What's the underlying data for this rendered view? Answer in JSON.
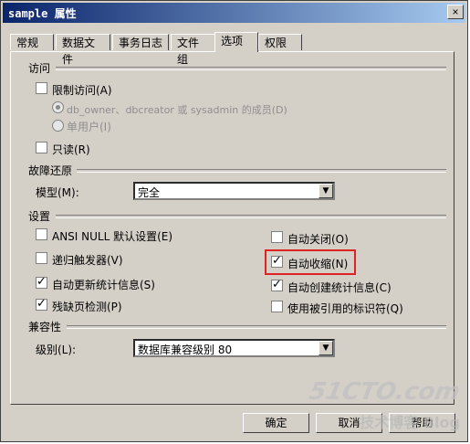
{
  "window": {
    "title": "sample 属性",
    "close": "×"
  },
  "tabs": [
    {
      "label": "常规"
    },
    {
      "label": "数据文件"
    },
    {
      "label": "事务日志"
    },
    {
      "label": "文件组"
    },
    {
      "label": "选项"
    },
    {
      "label": "权限"
    }
  ],
  "access": {
    "heading": "访问",
    "restrict": "限制访问(A)",
    "members": "db_owner、dbcreator 或 sysadmin 的成员(D)",
    "single": "单用户(I)",
    "readonly": "只读(R)"
  },
  "recovery": {
    "heading": "故障还原",
    "model_label": "模型(M):",
    "model_value": "完全"
  },
  "settings": {
    "heading": "设置",
    "ansi_null": "ANSI NULL 默认设置(E)",
    "recursive": "递归触发器(V)",
    "auto_update": "自动更新统计信息(S)",
    "torn_page": "残缺页检测(P)",
    "auto_close": "自动关闭(O)",
    "auto_shrink": "自动收缩(N)",
    "auto_create": "自动创建统计信息(C)",
    "quoted": "使用被引用的标识符(Q)"
  },
  "compat": {
    "heading": "兼容性",
    "level_label": "级别(L):",
    "level_value": "数据库兼容级别 80"
  },
  "buttons": {
    "ok": "确定",
    "cancel": "取消",
    "help": "帮助"
  },
  "watermark": {
    "main": "51CTO.com",
    "sub": "技术博客 Blog"
  }
}
